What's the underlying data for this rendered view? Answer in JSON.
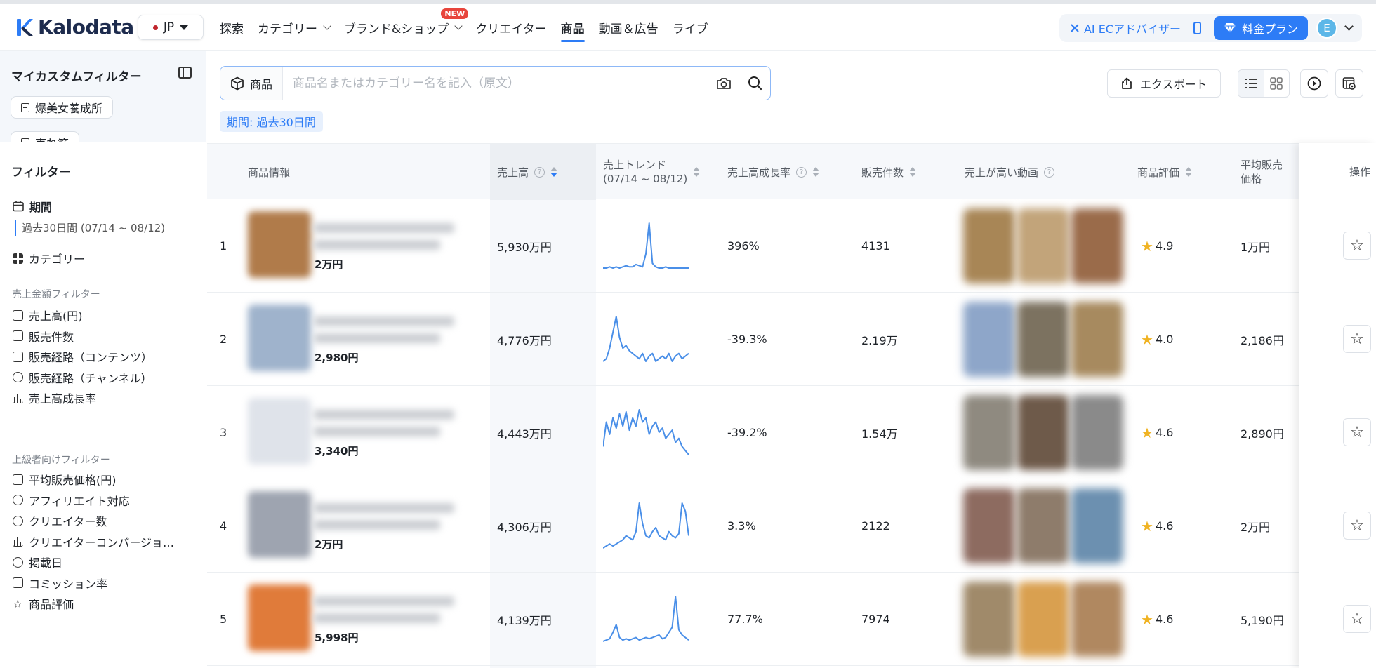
{
  "app": {
    "logo_text": "Kalodata"
  },
  "header": {
    "region": "JP",
    "nav": [
      {
        "label": "探索"
      },
      {
        "label": "カテゴリー",
        "dropdown": true
      },
      {
        "label": "ブランド&ショップ",
        "dropdown": true,
        "badge": "NEW"
      },
      {
        "label": "クリエイター"
      },
      {
        "label": "商品",
        "active": true
      },
      {
        "label": "動画＆広告"
      },
      {
        "label": "ライブ"
      }
    ],
    "advisor": "AI ECアドバイザー",
    "plan": "料金プラン",
    "avatar": "E"
  },
  "sidebar": {
    "custom_title": "マイカスタムフィルター",
    "custom_filters": [
      "爆美女養成所",
      "売れ筋"
    ],
    "filter_title": "フィルター",
    "period_label": "期間",
    "period_value": "過去30日間 (07/14 ~ 08/12)",
    "category_label": "カテゴリー",
    "group1": "売上金額フィルター",
    "group1_items": [
      "売上高(円)",
      "販売件数",
      "販売経路（コンテンツ）",
      "販売経路（チャンネル）",
      "売上高成長率"
    ],
    "group2": "上級者向けフィルター",
    "group2_items": [
      "平均販売価格(円)",
      "アフィリエイト対応",
      "クリエイター数",
      "クリエイターコンバージョ…",
      "掲載日",
      "コミッション率",
      "商品評価"
    ]
  },
  "search": {
    "type": "商品",
    "placeholder": "商品名またはカテゴリー名を記入（原文）",
    "period_tag": "期間: 過去30日間"
  },
  "toolbar": {
    "export": "エクスポート"
  },
  "table": {
    "headers": {
      "product": "商品情報",
      "sales": "売上高",
      "trend_line1": "売上トレンド",
      "trend_line2": "(07/14 ~ 08/12)",
      "growth": "売上高成長率",
      "units": "販売件数",
      "videos": "売上が高い動画",
      "rating": "商品評価",
      "avg_price_line1": "平均販売",
      "avg_price_line2": "価格",
      "ops": "操作"
    },
    "rows": [
      {
        "rank": "1",
        "price": "2万円",
        "sales": "5,930万円",
        "growth": "396%",
        "units": "4131",
        "rating": "4.9",
        "avg": "1万円",
        "trend": [
          2,
          2,
          3,
          2,
          3,
          2,
          3,
          4,
          3,
          3,
          5,
          4,
          3,
          14,
          40,
          6,
          3,
          2,
          2,
          3,
          2,
          2,
          2,
          2,
          2,
          2,
          2
        ],
        "thumb": "#b07b4a",
        "vids": [
          "#a88656",
          "#c2a47a",
          "#9a6b4a"
        ]
      },
      {
        "rank": "2",
        "price": "2,980円",
        "sales": "4,776万円",
        "growth": "-39.3%",
        "units": "2.19万",
        "rating": "4.0",
        "avg": "2,186円",
        "trend": [
          3,
          4,
          8,
          14,
          20,
          12,
          8,
          9,
          7,
          6,
          5,
          4,
          6,
          3,
          5,
          6,
          3,
          4,
          5,
          4,
          6,
          3,
          5,
          6,
          4,
          5,
          6
        ],
        "thumb": "#9fb3cc",
        "vids": [
          "#8ea6c9",
          "#7c7260",
          "#a78a5f"
        ]
      },
      {
        "rank": "3",
        "price": "3,340円",
        "sales": "4,443万円",
        "growth": "-39.2%",
        "units": "1.54万",
        "rating": "4.6",
        "avg": "2,890円",
        "trend": [
          8,
          20,
          14,
          22,
          17,
          24,
          18,
          25,
          16,
          22,
          18,
          26,
          20,
          22,
          14,
          18,
          20,
          15,
          17,
          12,
          14,
          16,
          10,
          12,
          8,
          6,
          4
        ],
        "thumb": "#dfe3ea",
        "vids": [
          "#8f8a80",
          "#6e5a4a",
          "#8a8a8a"
        ]
      },
      {
        "rank": "4",
        "price": "2万円",
        "sales": "4,306万円",
        "growth": "3.3%",
        "units": "2122",
        "rating": "4.6",
        "avg": "2万円",
        "trend": [
          4,
          5,
          6,
          5,
          6,
          7,
          8,
          10,
          9,
          8,
          12,
          26,
          16,
          10,
          9,
          12,
          14,
          10,
          9,
          8,
          12,
          10,
          9,
          11,
          26,
          22,
          10
        ],
        "thumb": "#9ea4b0",
        "vids": [
          "#8d6b60",
          "#8e7c6b",
          "#6c90b0"
        ]
      },
      {
        "rank": "5",
        "price": "5,998円",
        "sales": "4,139万円",
        "growth": "77.7%",
        "units": "7974",
        "rating": "4.6",
        "avg": "5,190円",
        "trend": [
          3,
          4,
          5,
          10,
          16,
          6,
          4,
          5,
          4,
          5,
          6,
          4,
          5,
          6,
          5,
          6,
          7,
          8,
          5,
          6,
          10,
          14,
          38,
          12,
          8,
          6,
          4
        ],
        "thumb": "#e07b3a",
        "vids": [
          "#a08a6a",
          "#d9a050",
          "#b08860"
        ]
      }
    ]
  },
  "colors": {
    "accent": "#2d7cf6",
    "star": "#f0b323",
    "spark": "#4a8fe8",
    "new_badge": "#e8453c"
  }
}
